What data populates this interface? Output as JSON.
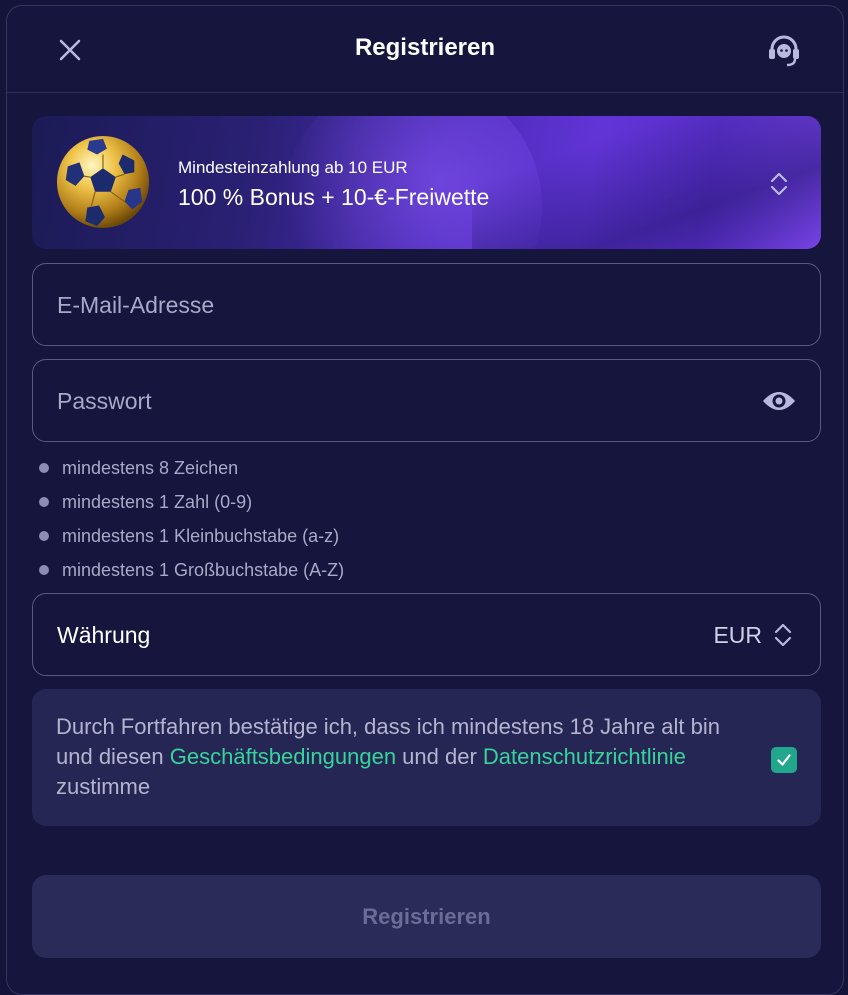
{
  "header": {
    "title": "Registrieren",
    "close_icon": "close-icon",
    "support_icon": "headset-icon"
  },
  "banner": {
    "small_text": "Mindesteinzahlung ab 10 EUR",
    "big_text": "100 % Bonus + 10-€-Freiwette",
    "image": "football-icon",
    "chevron_icon": "chevron-updown-icon"
  },
  "form": {
    "email_placeholder": "E-Mail-Adresse",
    "password_placeholder": "Passwort",
    "eye_icon": "eye-icon",
    "password_rules": [
      "mindestens 8 Zeichen",
      "mindestens 1 Zahl (0-9)",
      "mindestens 1 Kleinbuchstabe (a-z)",
      "mindestens 1 Großbuchstabe (A-Z)"
    ],
    "currency_label": "Währung",
    "currency_value": "EUR"
  },
  "terms": {
    "text_1": "Durch Fortfahren bestätige ich, dass ich mindestens 18 Jahre alt bin und diesen ",
    "link_terms": "Geschäftsbedingungen",
    "text_2": " und der ",
    "link_privacy": "Datenschutzrichtlinie",
    "text_3": " zustimme",
    "checked": true
  },
  "submit_label": "Registrieren",
  "colors": {
    "background": "#15153d",
    "accent_green": "#36d39a",
    "checkbox": "#23a78c",
    "banner_purple": "#6134d6"
  }
}
